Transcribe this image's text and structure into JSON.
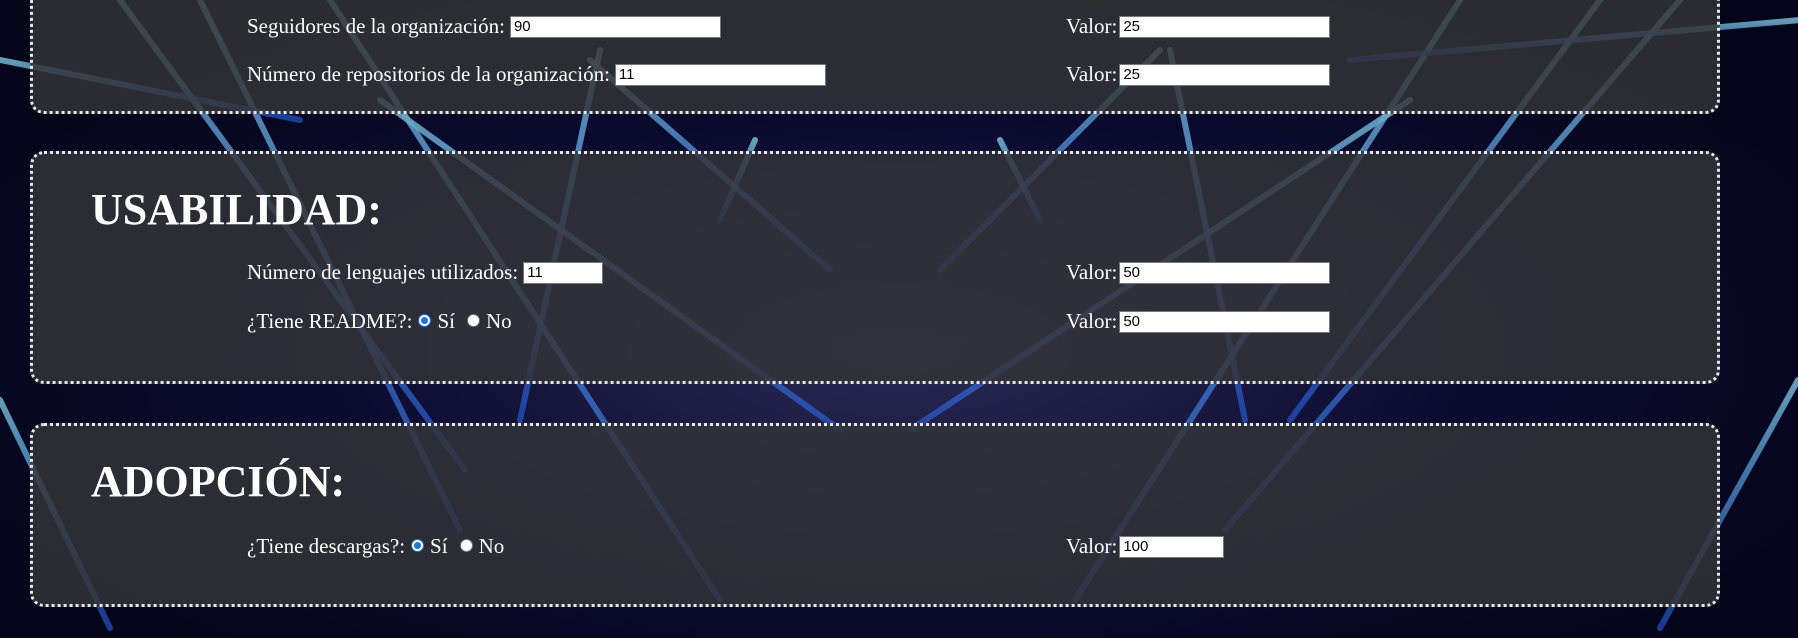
{
  "sections": {
    "top": {
      "rows": [
        {
          "label": "Seguidores de la organización:",
          "value": "90",
          "valor_label": "Valor:",
          "valor": "25"
        },
        {
          "label": "Número de repositorios de la organización:",
          "value": "11",
          "valor_label": "Valor:",
          "valor": "25"
        }
      ]
    },
    "usabilidad": {
      "title": "USABILIDAD:",
      "languages": {
        "label": "Número de lenguajes utilizados:",
        "value": "11",
        "valor_label": "Valor:",
        "valor": "50"
      },
      "readme": {
        "label": "¿Tiene README?:",
        "yes_label": "Sí",
        "no_label": "No",
        "selected": "Sí",
        "valor_label": "Valor:",
        "valor": "50"
      }
    },
    "adopcion": {
      "title": "ADOPCIÓN:",
      "downloads": {
        "label": "¿Tiene descargas?:",
        "yes_label": "Sí",
        "no_label": "No",
        "selected": "Sí",
        "valor_label": "Valor:",
        "valor": "100"
      }
    }
  },
  "colors": {
    "panel_border": "#e8e8e8",
    "panel_background": "#343438",
    "radio_selected": "#1a73e8",
    "neon_beam": "#5fd0ff"
  }
}
